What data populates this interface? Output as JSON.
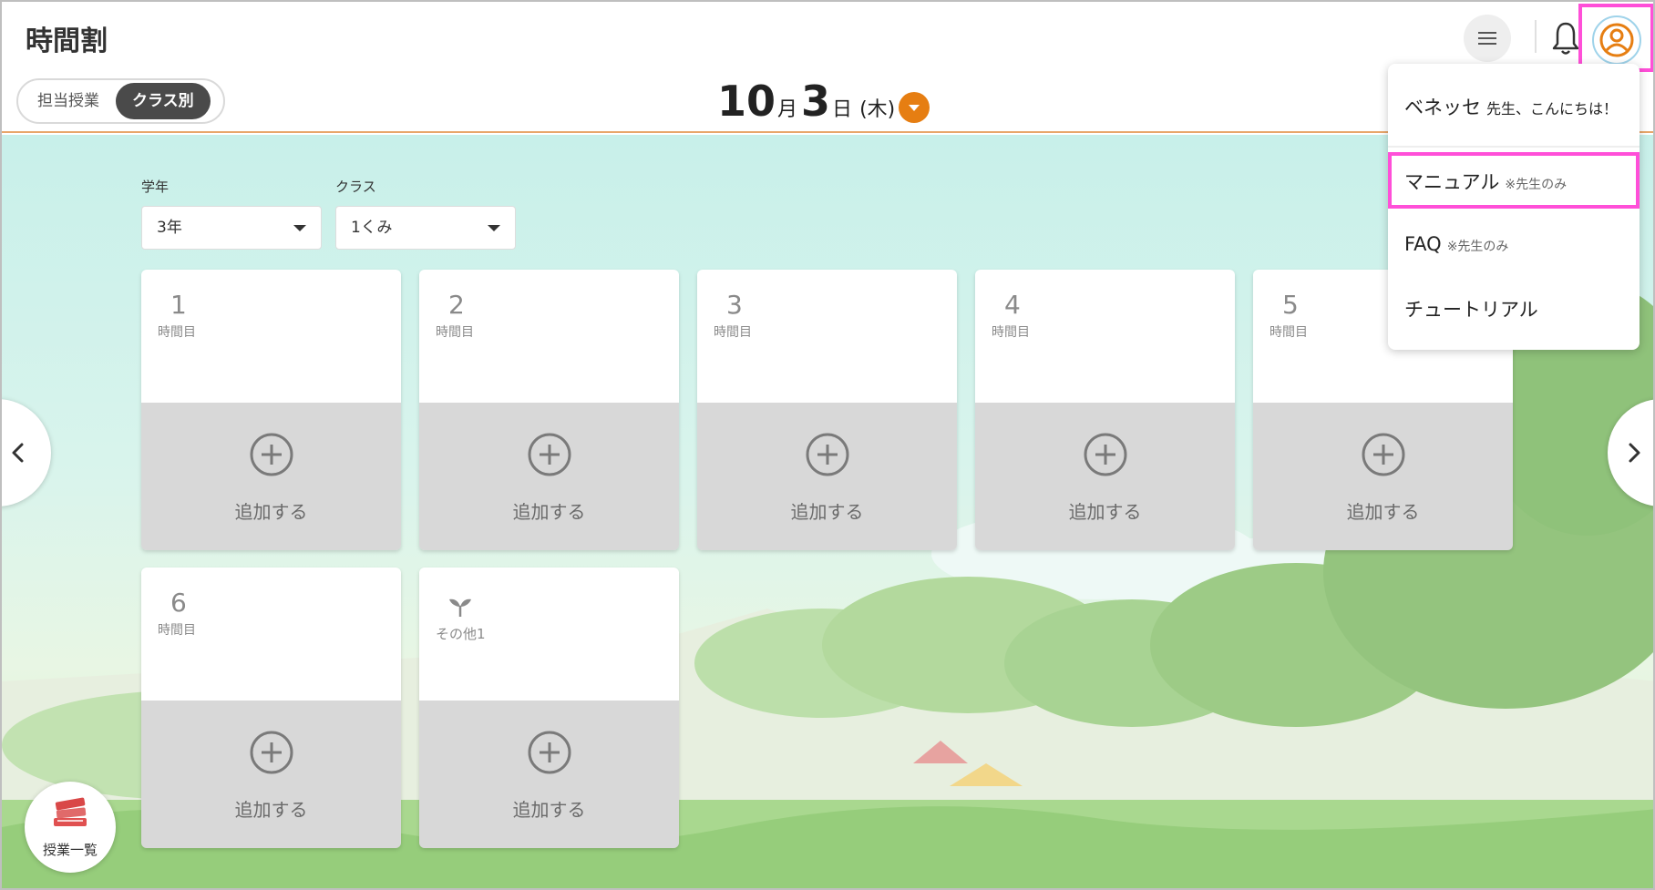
{
  "app": {
    "title": "時間割"
  },
  "view_toggle": {
    "options": [
      "担当授業",
      "クラス別"
    ],
    "active": "クラス別"
  },
  "date": {
    "month": "10",
    "month_unit": "月",
    "day": "3",
    "day_unit": "日",
    "weekday": "(木)"
  },
  "filters": {
    "grade_label": "学年",
    "grade_value": "3年",
    "class_label": "クラス",
    "class_value": "1くみ"
  },
  "periods": [
    {
      "number": "1",
      "label": "時間目",
      "add_label": "追加する"
    },
    {
      "number": "2",
      "label": "時間目",
      "add_label": "追加する"
    },
    {
      "number": "3",
      "label": "時間目",
      "add_label": "追加する"
    },
    {
      "number": "4",
      "label": "時間目",
      "add_label": "追加する"
    },
    {
      "number": "5",
      "label": "時間目",
      "add_label": "追加する"
    },
    {
      "number": "6",
      "label": "時間目",
      "add_label": "追加する"
    }
  ],
  "other_period": {
    "label": "その他1",
    "add_label": "追加する"
  },
  "user_menu": {
    "greeting_name": "ベネッセ",
    "greeting_text": "先生、こんにちは！",
    "items": [
      {
        "label": "マニュアル",
        "note": "※先生のみ"
      },
      {
        "label": "FAQ",
        "note": "※先生のみ"
      },
      {
        "label": "チュートリアル",
        "note": ""
      }
    ]
  },
  "lessons_button": {
    "label": "授業一覧"
  },
  "icons": {
    "menu": "hamburger-icon",
    "bell": "bell-icon",
    "profile": "user-circle-icon",
    "prev": "chevron-left-icon",
    "next": "chevron-right-icon",
    "add": "plus-circle-icon",
    "lessons": "books-icon",
    "sprout": "sprout-icon"
  },
  "colors": {
    "accent": "#e67e12",
    "highlight": "#ff4fd8",
    "add_bg": "#d8d8d8"
  }
}
